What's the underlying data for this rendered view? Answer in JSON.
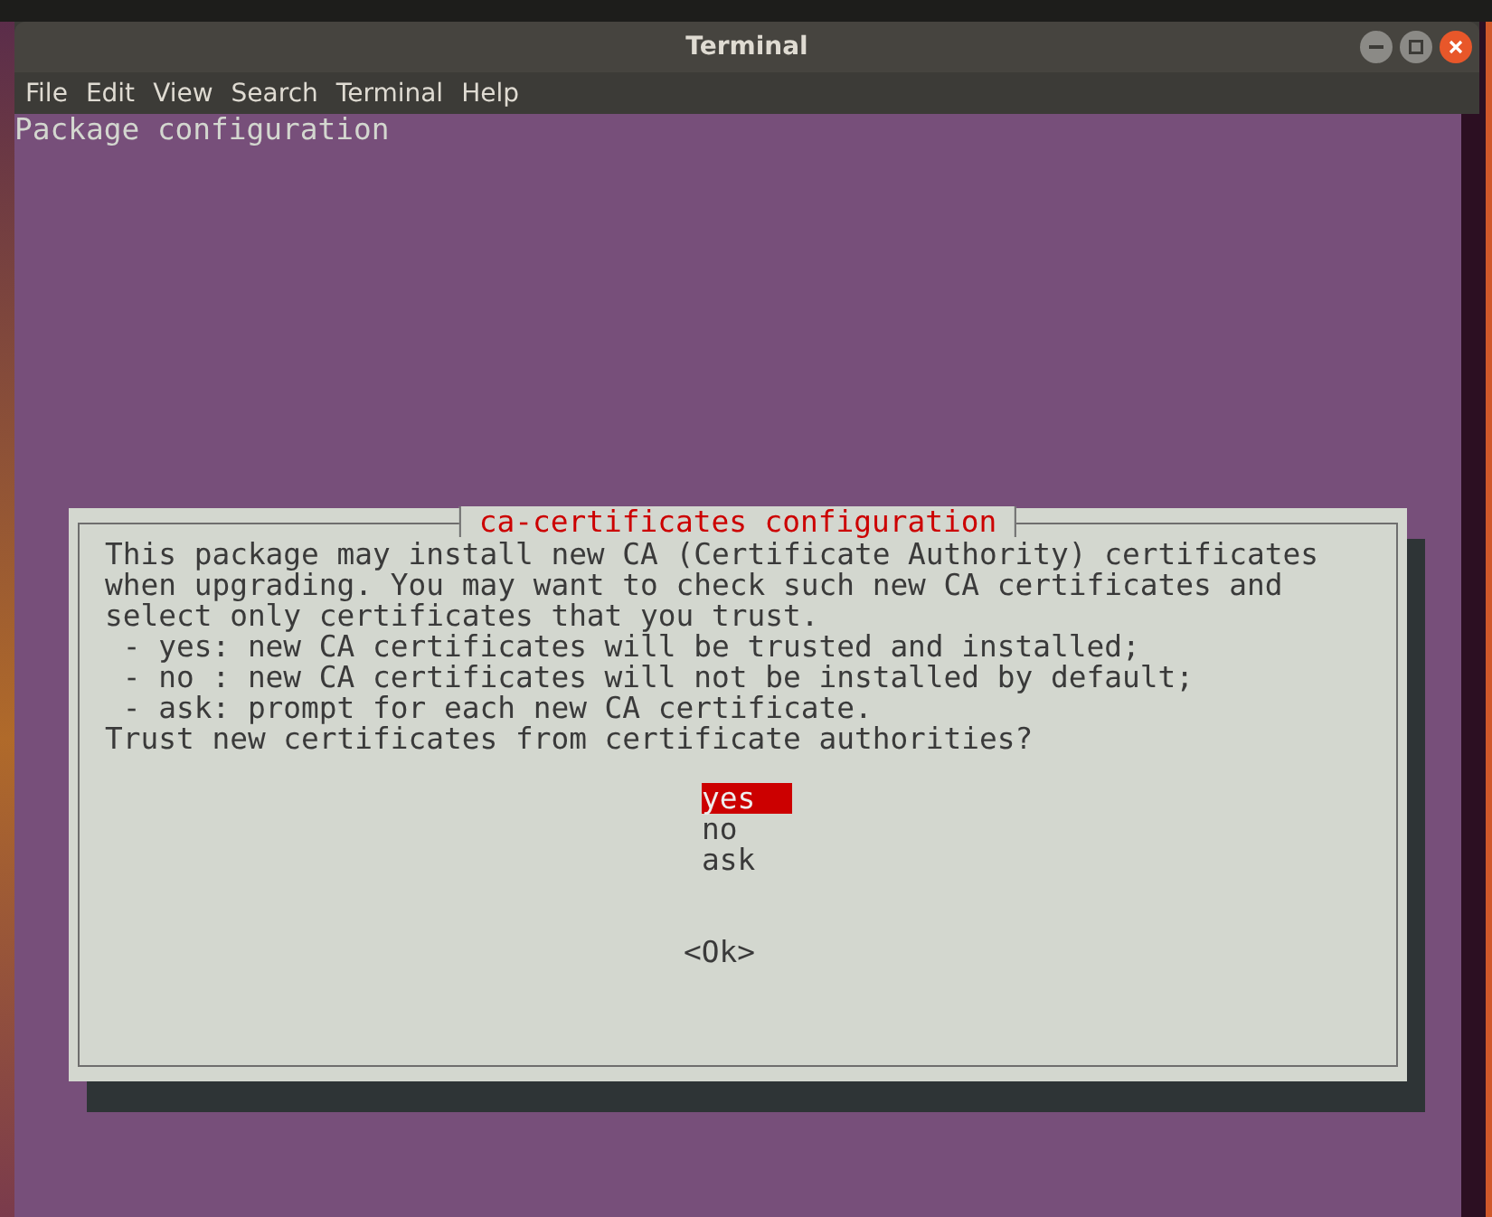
{
  "window": {
    "title": "Terminal"
  },
  "menu": [
    "File",
    "Edit",
    "View",
    "Search",
    "Terminal",
    "Help"
  ],
  "terminal": {
    "header": "Package configuration"
  },
  "dialog": {
    "title": "ca-certificates configuration",
    "paragraph": [
      "This package may install new CA (Certificate Authority) certificates",
      "when upgrading. You may want to check such new CA certificates and",
      "select only certificates that you trust."
    ],
    "bullets": [
      " - yes: new CA certificates will be trusted and installed;",
      " - no : new CA certificates will not be installed by default;",
      " - ask: prompt for each new CA certificate."
    ],
    "question": "Trust new certificates from certificate authorities?",
    "options": [
      {
        "label": "yes",
        "selected": true
      },
      {
        "label": "no",
        "selected": false
      },
      {
        "label": "ask",
        "selected": false
      }
    ],
    "button": "<Ok>"
  }
}
